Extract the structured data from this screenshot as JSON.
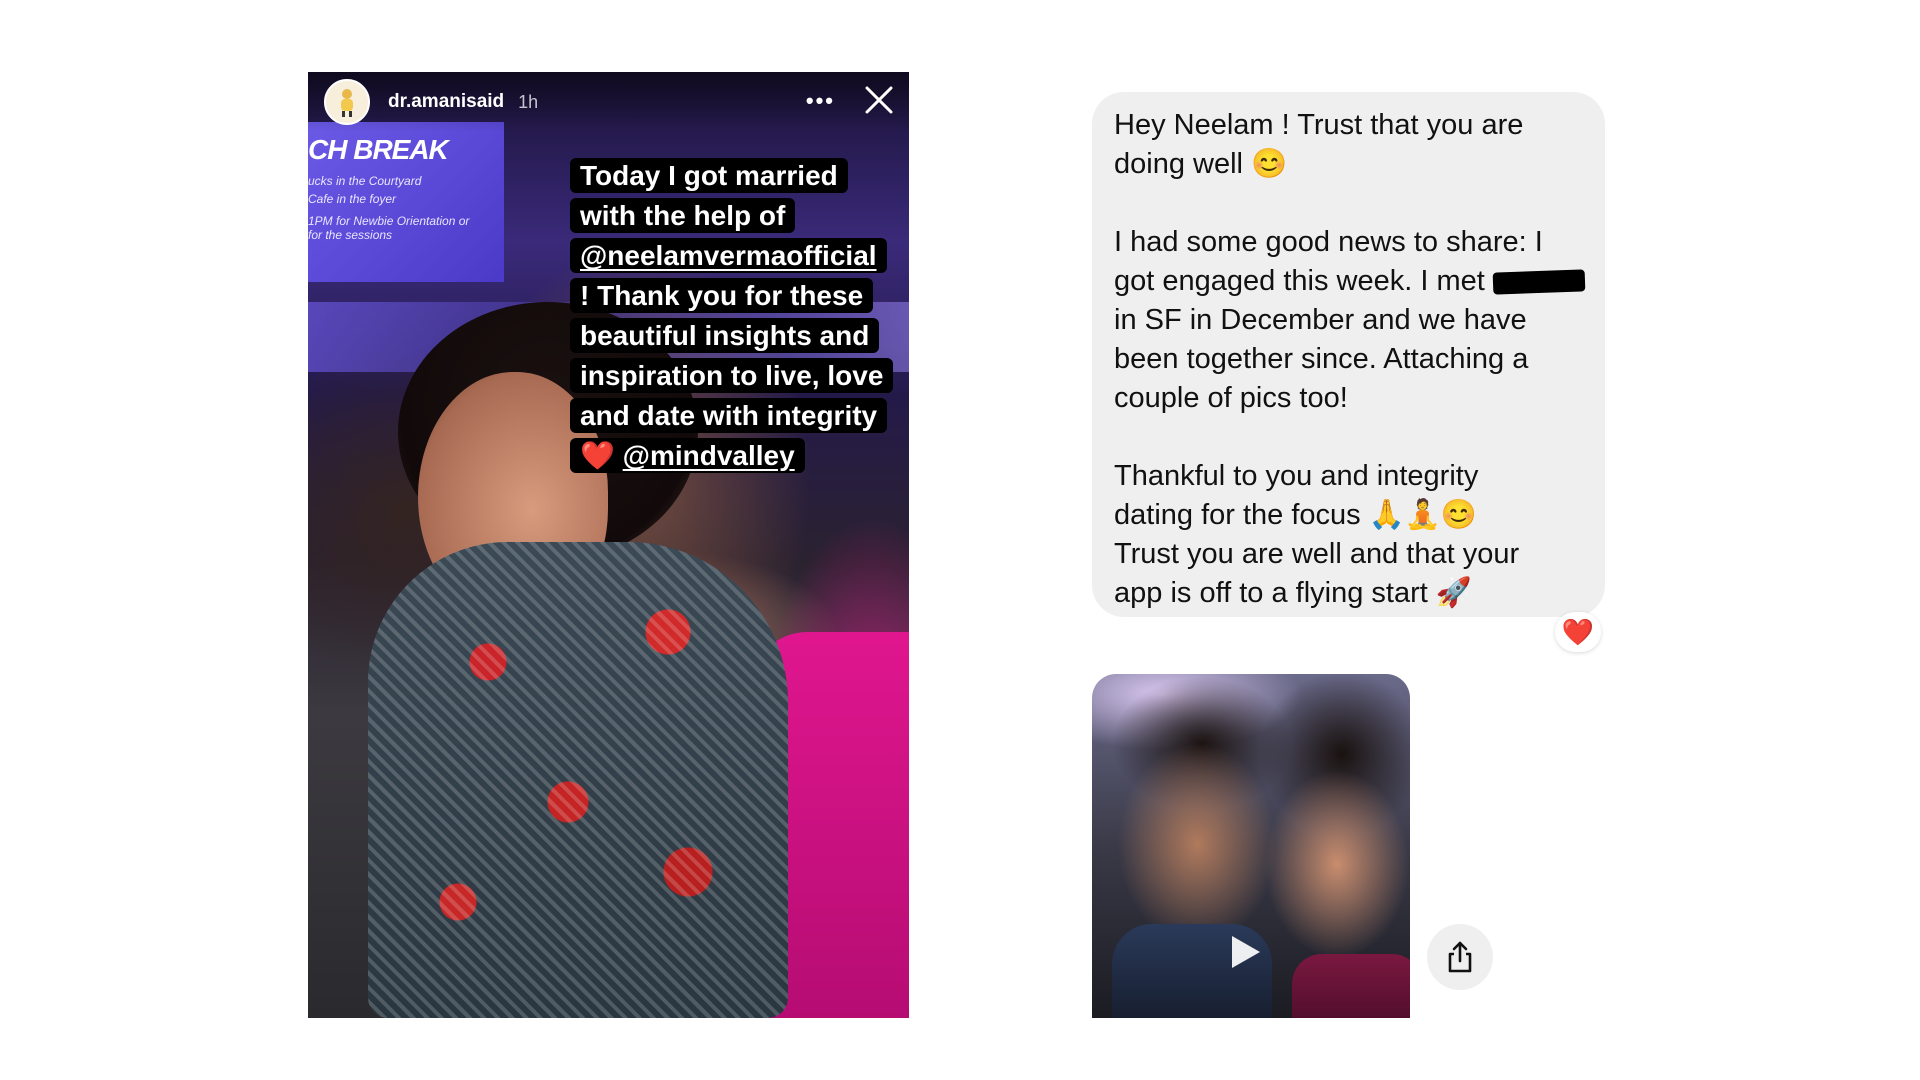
{
  "story": {
    "username": "dr.amanisaid",
    "time": "1h",
    "more_icon": "more-horizontal-icon",
    "close_icon": "close-icon",
    "stage_screen": {
      "title": "CH BREAK",
      "lines": [
        "ucks in the Courtyard",
        "Cafe in the foyer",
        "1PM for Newbie Orientation or",
        "for the sessions"
      ]
    },
    "caption": {
      "line1": "Today I got married",
      "line2": "with the help of",
      "mention1": "@neelamvermaofficial",
      "line4": "! Thank you for these",
      "line5": "beautiful insights and",
      "line6": "inspiration to live, love",
      "line7": "and date with integrity",
      "heart": "❤️",
      "mention2": "@mindvalley"
    }
  },
  "message": {
    "lines": [
      "Hey Neelam ! Trust that you are",
      "doing well 😊",
      "",
      "I had some good news to share:  I",
      "got engaged this week. I met",
      "in SF in December and we have",
      "been together since. Attaching a",
      "couple of pics too!",
      "",
      "Thankful to you and integrity",
      "dating for the focus 🙏🧘😊",
      "Trust you are well and that your",
      "app is off to a flying start 🚀"
    ],
    "reaction": "❤️"
  },
  "attachment": {
    "play_icon": "play-icon",
    "share_icon": "share-icon"
  },
  "colors": {
    "bubble_bg": "#efefef",
    "caption_bg": "#000000",
    "reaction_heart": "#e0242e",
    "accent_pink": "#e0168f"
  }
}
